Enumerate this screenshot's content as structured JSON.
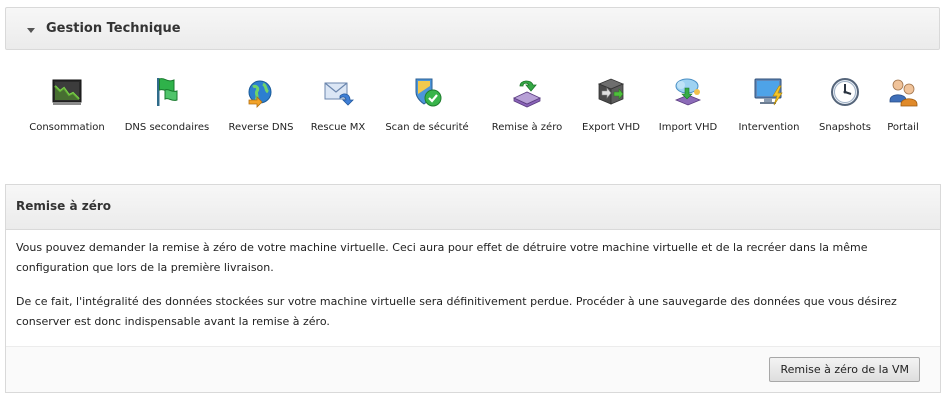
{
  "header": {
    "title": "Gestion Technique"
  },
  "toolbar": {
    "items": [
      {
        "label": "Consommation",
        "icon": "chart-monitor-icon"
      },
      {
        "label": "DNS secondaires",
        "icon": "green-flag-icon"
      },
      {
        "label": "Reverse DNS",
        "icon": "globe-arrow-icon"
      },
      {
        "label": "Rescue MX",
        "icon": "envelope-icon"
      },
      {
        "label": "Scan de sécurité",
        "icon": "shield-check-icon"
      },
      {
        "label": "Remise à zéro",
        "icon": "reset-disk-icon"
      },
      {
        "label": "Export VHD",
        "icon": "export-vhd-icon"
      },
      {
        "label": "Import VHD",
        "icon": "import-vhd-icon"
      },
      {
        "label": "Intervention",
        "icon": "monitor-bolt-icon"
      },
      {
        "label": "Snapshots",
        "icon": "clock-icon"
      },
      {
        "label": "Portail",
        "icon": "users-icon"
      }
    ]
  },
  "section": {
    "title": "Remise à zéro",
    "paragraph1": "Vous pouvez demander la remise à zéro de votre machine virtuelle. Ceci aura pour effet de détruire votre machine virtuelle et de la recréer dans la même configuration que lors de la première livraison.",
    "paragraph2": "De ce fait, l'intégralité des données stockées sur votre machine virtuelle sera définitivement perdue. Procéder à une sauvegarde des données que vous désirez conserver est donc indispensable avant la remise à zéro.",
    "button_label": "Remise à zéro de la VM"
  },
  "colors": {
    "panel_border": "#d9d9d9",
    "panel_bg": "#efefef",
    "text": "#222222"
  }
}
